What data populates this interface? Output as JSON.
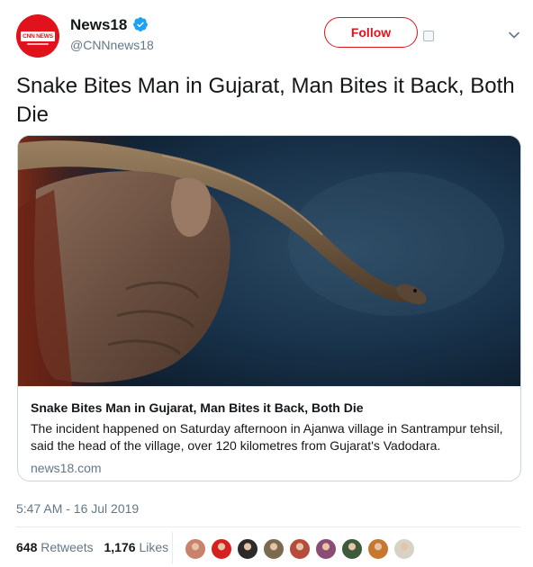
{
  "account": {
    "name": "News18",
    "handle": "@CNNnews18",
    "avatar_text": "CNN NEWS 18",
    "verified": true
  },
  "actions": {
    "follow_label": "Follow"
  },
  "tweet": {
    "text": "Snake Bites Man in Gujarat, Man Bites it Back, Both Die"
  },
  "card": {
    "title": "Snake Bites Man in Gujarat, Man Bites it Back, Both Die",
    "description": "The incident happened on Saturday afternoon in Ajanwa village in Santrampur tehsil, said the head of the village, over 120 kilometres from Gujarat's Vadodara.",
    "domain": "news18.com"
  },
  "meta": {
    "timestamp": "5:47 AM - 16 Jul 2019"
  },
  "stats": {
    "retweets_count": "648",
    "retweets_label": "Retweets",
    "likes_count": "1,176",
    "likes_label": "Likes"
  },
  "likers": [
    {
      "color": "#c9826b"
    },
    {
      "color": "#d61f1f"
    },
    {
      "color": "#2b2b2b"
    },
    {
      "color": "#7a6a4f"
    },
    {
      "color": "#b54c3c"
    },
    {
      "color": "#8a4b74"
    },
    {
      "color": "#3d5a3a"
    },
    {
      "color": "#c7772e"
    },
    {
      "color": "#d8d2c6"
    }
  ],
  "colors": {
    "brand": "#e0121b",
    "verified": "#1da1f2",
    "muted": "#657786"
  }
}
